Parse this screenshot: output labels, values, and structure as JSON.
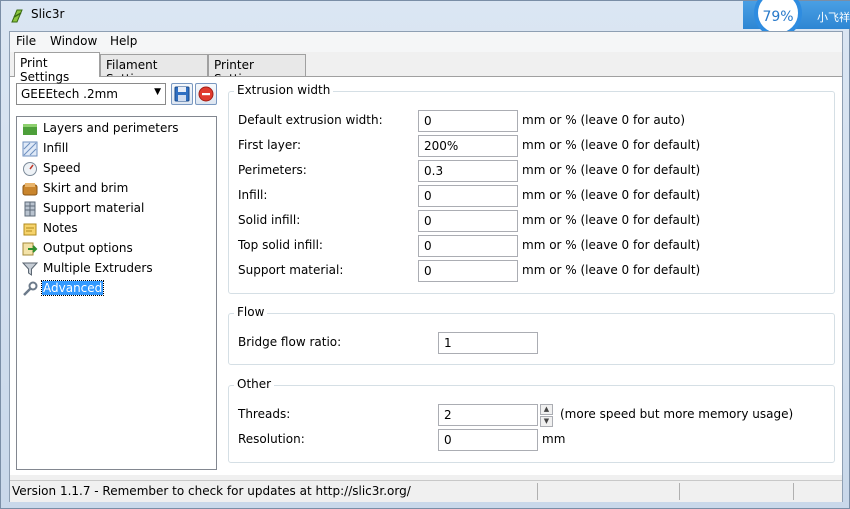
{
  "window": {
    "title": "Slic3r",
    "badge_percent": "79%",
    "badge_user": "小飞祥"
  },
  "menu": [
    "File",
    "Window",
    "Help"
  ],
  "tabs": [
    "Print Settings",
    "Filament Settings",
    "Printer Settings"
  ],
  "preset": {
    "selected": "GEEEtech .2mm"
  },
  "sidebar": {
    "items": [
      {
        "label": "Layers and perimeters",
        "icon": "layers-icon"
      },
      {
        "label": "Infill",
        "icon": "infill-icon"
      },
      {
        "label": "Speed",
        "icon": "speed-icon"
      },
      {
        "label": "Skirt and brim",
        "icon": "skirt-icon"
      },
      {
        "label": "Support material",
        "icon": "support-icon"
      },
      {
        "label": "Notes",
        "icon": "notes-icon"
      },
      {
        "label": "Output options",
        "icon": "output-icon"
      },
      {
        "label": "Multiple Extruders",
        "icon": "funnel-icon"
      },
      {
        "label": "Advanced",
        "icon": "wrench-icon"
      }
    ],
    "selected_index": 8
  },
  "extrusion": {
    "title": "Extrusion width",
    "rows": [
      {
        "label": "Default extrusion width:",
        "value": "0",
        "hint": "mm or % (leave 0 for auto)"
      },
      {
        "label": "First layer:",
        "value": "200%",
        "hint": "mm or % (leave 0 for default)"
      },
      {
        "label": "Perimeters:",
        "value": "0.3",
        "hint": "mm or % (leave 0 for default)"
      },
      {
        "label": "Infill:",
        "value": "0",
        "hint": "mm or % (leave 0 for default)"
      },
      {
        "label": "Solid infill:",
        "value": "0",
        "hint": "mm or % (leave 0 for default)"
      },
      {
        "label": "Top solid infill:",
        "value": "0",
        "hint": "mm or % (leave 0 for default)"
      },
      {
        "label": "Support material:",
        "value": "0",
        "hint": "mm or % (leave 0 for default)"
      }
    ]
  },
  "flow": {
    "title": "Flow",
    "bridge_label": "Bridge flow ratio:",
    "bridge_value": "1"
  },
  "other": {
    "title": "Other",
    "threads_label": "Threads:",
    "threads_value": "2",
    "threads_hint": "(more speed but more memory usage)",
    "resolution_label": "Resolution:",
    "resolution_value": "0",
    "resolution_hint": "mm"
  },
  "status": {
    "text": "Version 1.1.7 - Remember to check for updates at http://slic3r.org/"
  },
  "colors": {
    "selection": "#3399ff",
    "badge_blue": "#2e8ce0"
  }
}
